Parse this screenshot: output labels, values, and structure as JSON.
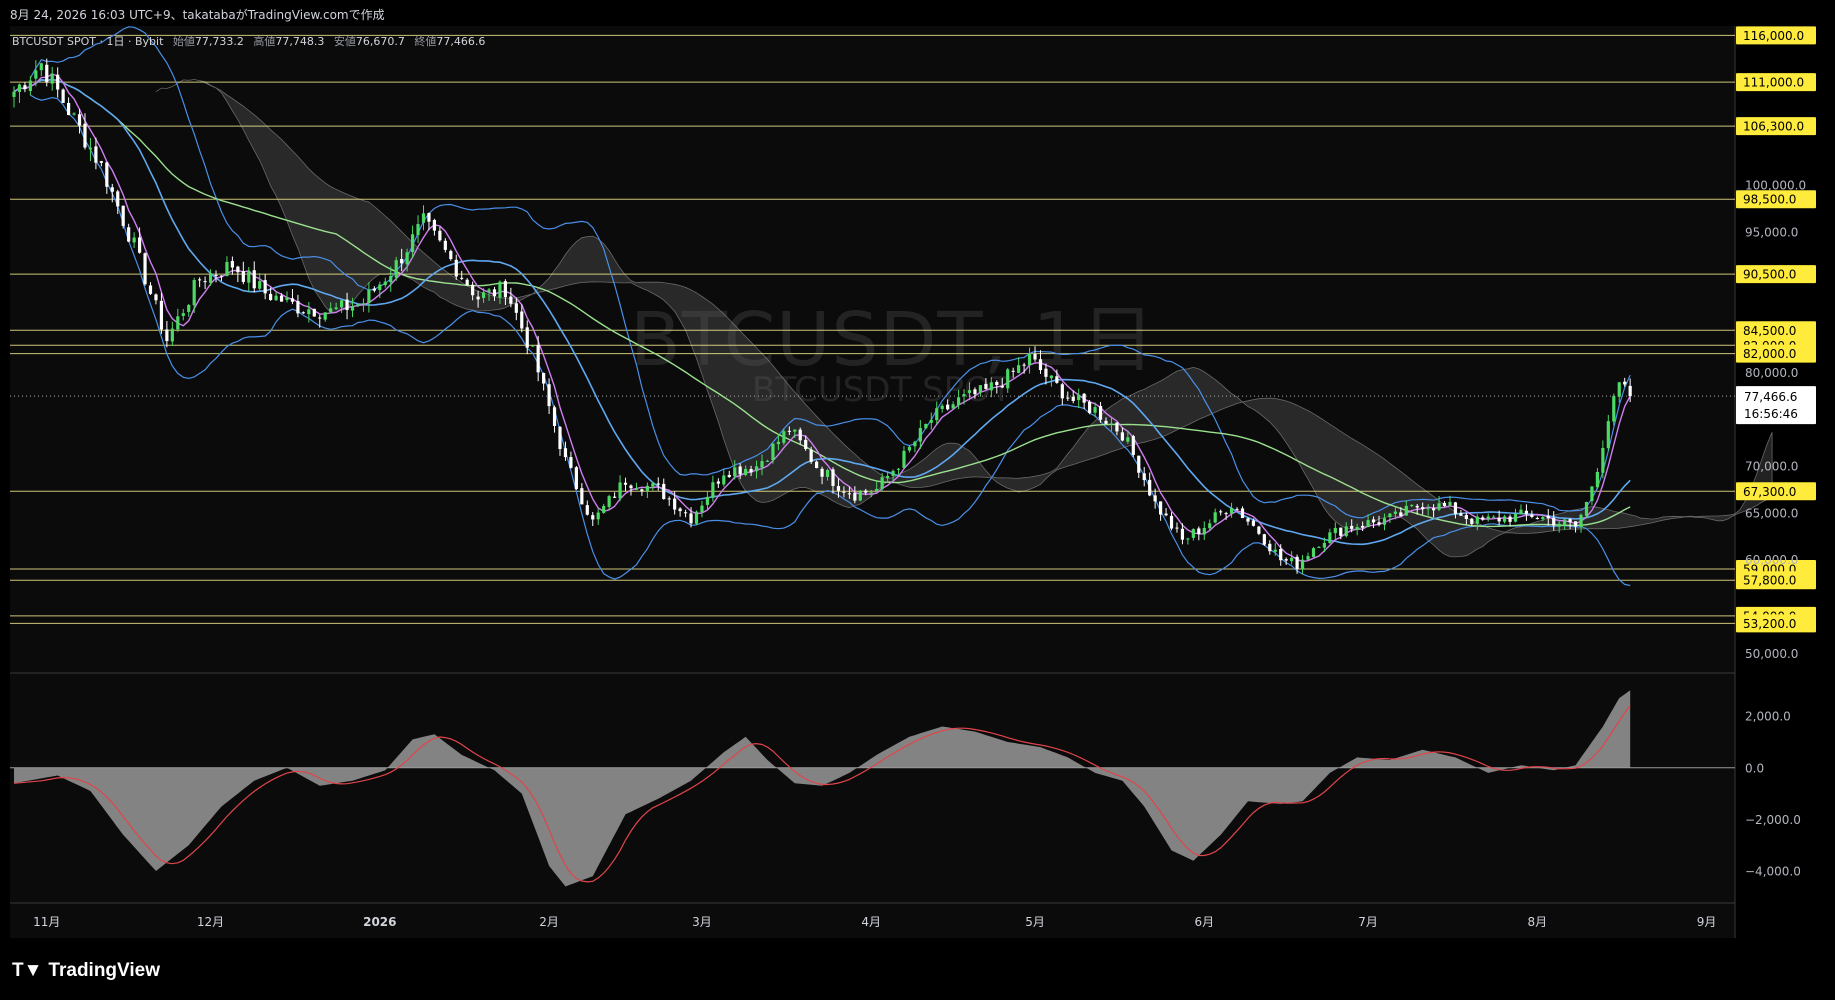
{
  "header": {
    "caption": "8月 24, 2026 16:03 UTC+9、takatabaがTradingView.comで作成"
  },
  "legend": {
    "symbol": "BTCUSDT SPOT · 1日 · Bybit",
    "open_label": "始値",
    "open": "77,733.2",
    "high_label": "高値",
    "high": "77,748.3",
    "low_label": "安値",
    "low": "76,670.7",
    "close_label": "終値",
    "close": "77,466.6"
  },
  "watermark": {
    "main": "BTCUSDT, 1日",
    "sub": "BTCUSDT SPOT"
  },
  "price_tag": {
    "price": "77,466.6",
    "countdown": "16:56:46"
  },
  "footer": {
    "brand": "TradingView",
    "logo_icon": "tradingview-logo-icon"
  },
  "colors": {
    "background": "#0b0b0b",
    "up": "#4cd964",
    "down": "#ffffff",
    "level": "#f0e68c",
    "level_tag": "#ffeb3b",
    "bollinger": "#4a8fe7",
    "ma_fast": "#d07ef0",
    "ma_mid": "#5fa8f0",
    "ma_slow": "#9be08e",
    "cloud": "#606060",
    "macd_hist": "#8a8a8a",
    "macd_signal": "#e0454b"
  },
  "chart_data": [
    {
      "type": "candlestick",
      "title": "BTCUSDT SPOT · 1日 · Bybit",
      "x_labels": [
        "11月",
        "12月",
        "2026",
        "2月",
        "3月",
        "4月",
        "5月",
        "6月",
        "7月",
        "8月",
        "9月"
      ],
      "x_label_days": [
        6,
        36,
        67,
        98,
        126,
        157,
        187,
        218,
        248,
        279,
        310
      ],
      "y_ticks": [
        "100,000.0",
        "95,000.0",
        "80,000.0",
        "70,000.0",
        "65,000.0",
        "60,000.0",
        "50,000.0"
      ],
      "y_tick_values": [
        100000,
        95000,
        80000,
        70000,
        65000,
        60000,
        50000
      ],
      "ylim": [
        48000,
        117000
      ],
      "horizontal_levels": [
        "116,000.0",
        "111,000.0",
        "106,300.0",
        "98,500.0",
        "90,500.0",
        "84,500.0",
        "82,900.0",
        "82,000.0",
        "67,300.0",
        "59,000.0",
        "57,800.0",
        "54,000.0",
        "53,200.0"
      ],
      "level_values": [
        116000,
        111000,
        106300,
        98500,
        90500,
        84500,
        82900,
        82000,
        67300,
        59000,
        57800,
        54000,
        53200
      ],
      "last_price": 77466.6,
      "anchors": [
        [
          0,
          110000
        ],
        [
          5,
          113000
        ],
        [
          10,
          108000
        ],
        [
          16,
          102000
        ],
        [
          22,
          93500
        ],
        [
          28,
          83500
        ],
        [
          34,
          90000
        ],
        [
          40,
          91500
        ],
        [
          46,
          88500
        ],
        [
          52,
          87000
        ],
        [
          58,
          86500
        ],
        [
          64,
          87500
        ],
        [
          70,
          91500
        ],
        [
          75,
          96000
        ],
        [
          80,
          92000
        ],
        [
          85,
          88000
        ],
        [
          90,
          89000
        ],
        [
          95,
          82000
        ],
        [
          101,
          70500
        ],
        [
          106,
          64000
        ],
        [
          112,
          68500
        ],
        [
          118,
          67500
        ],
        [
          124,
          64500
        ],
        [
          130,
          69500
        ],
        [
          136,
          70000
        ],
        [
          142,
          74000
        ],
        [
          147,
          70000
        ],
        [
          151,
          68000
        ],
        [
          154,
          67000
        ],
        [
          158,
          67500
        ],
        [
          163,
          71000
        ],
        [
          168,
          75000
        ],
        [
          173,
          77000
        ],
        [
          178,
          78000
        ],
        [
          182,
          79500
        ],
        [
          186,
          81500
        ],
        [
          190,
          79000
        ],
        [
          194,
          77000
        ],
        [
          198,
          76000
        ],
        [
          203,
          73500
        ],
        [
          206,
          70000
        ],
        [
          209,
          66000
        ],
        [
          214,
          62000
        ],
        [
          219,
          64000
        ],
        [
          223,
          66000
        ],
        [
          228,
          63000
        ],
        [
          232,
          60000
        ],
        [
          235,
          59500
        ],
        [
          239,
          62000
        ],
        [
          244,
          63500
        ],
        [
          249,
          64000
        ],
        [
          253,
          64500
        ],
        [
          258,
          66000
        ],
        [
          263,
          65500
        ],
        [
          268,
          64000
        ],
        [
          273,
          64500
        ],
        [
          278,
          64800
        ],
        [
          283,
          64000
        ],
        [
          286,
          63500
        ],
        [
          288,
          66000
        ],
        [
          290,
          70000
        ],
        [
          292,
          75000
        ],
        [
          294,
          78500
        ],
        [
          296,
          77467
        ]
      ],
      "last_day": 296
    },
    {
      "type": "area",
      "title": "MACD",
      "y_ticks": [
        "2,000.0",
        "0.0",
        "−2,000.0",
        "−4,000.0"
      ],
      "y_tick_values": [
        2000,
        0,
        -2000,
        -4000
      ],
      "ylim": [
        -5200,
        3400
      ],
      "histogram_anchors": [
        [
          0,
          -600
        ],
        [
          8,
          -300
        ],
        [
          14,
          -900
        ],
        [
          20,
          -2600
        ],
        [
          26,
          -4000
        ],
        [
          32,
          -3000
        ],
        [
          38,
          -1500
        ],
        [
          44,
          -500
        ],
        [
          50,
          0
        ],
        [
          56,
          -700
        ],
        [
          62,
          -500
        ],
        [
          68,
          -100
        ],
        [
          73,
          1100
        ],
        [
          77,
          1300
        ],
        [
          82,
          500
        ],
        [
          88,
          -100
        ],
        [
          93,
          -1000
        ],
        [
          98,
          -3800
        ],
        [
          101,
          -4600
        ],
        [
          106,
          -4200
        ],
        [
          112,
          -1800
        ],
        [
          118,
          -1200
        ],
        [
          124,
          -500
        ],
        [
          130,
          600
        ],
        [
          134,
          1200
        ],
        [
          138,
          300
        ],
        [
          143,
          -600
        ],
        [
          148,
          -700
        ],
        [
          153,
          -200
        ],
        [
          158,
          500
        ],
        [
          164,
          1200
        ],
        [
          170,
          1600
        ],
        [
          176,
          1400
        ],
        [
          182,
          1000
        ],
        [
          188,
          800
        ],
        [
          193,
          400
        ],
        [
          198,
          -200
        ],
        [
          203,
          -500
        ],
        [
          207,
          -1500
        ],
        [
          212,
          -3200
        ],
        [
          216,
          -3600
        ],
        [
          221,
          -2600
        ],
        [
          226,
          -1300
        ],
        [
          232,
          -1400
        ],
        [
          236,
          -1300
        ],
        [
          241,
          -200
        ],
        [
          246,
          400
        ],
        [
          252,
          300
        ],
        [
          258,
          700
        ],
        [
          264,
          400
        ],
        [
          270,
          -200
        ],
        [
          276,
          100
        ],
        [
          282,
          -100
        ],
        [
          286,
          100
        ],
        [
          288,
          700
        ],
        [
          291,
          1600
        ],
        [
          294,
          2700
        ],
        [
          296,
          3000
        ]
      ]
    }
  ]
}
